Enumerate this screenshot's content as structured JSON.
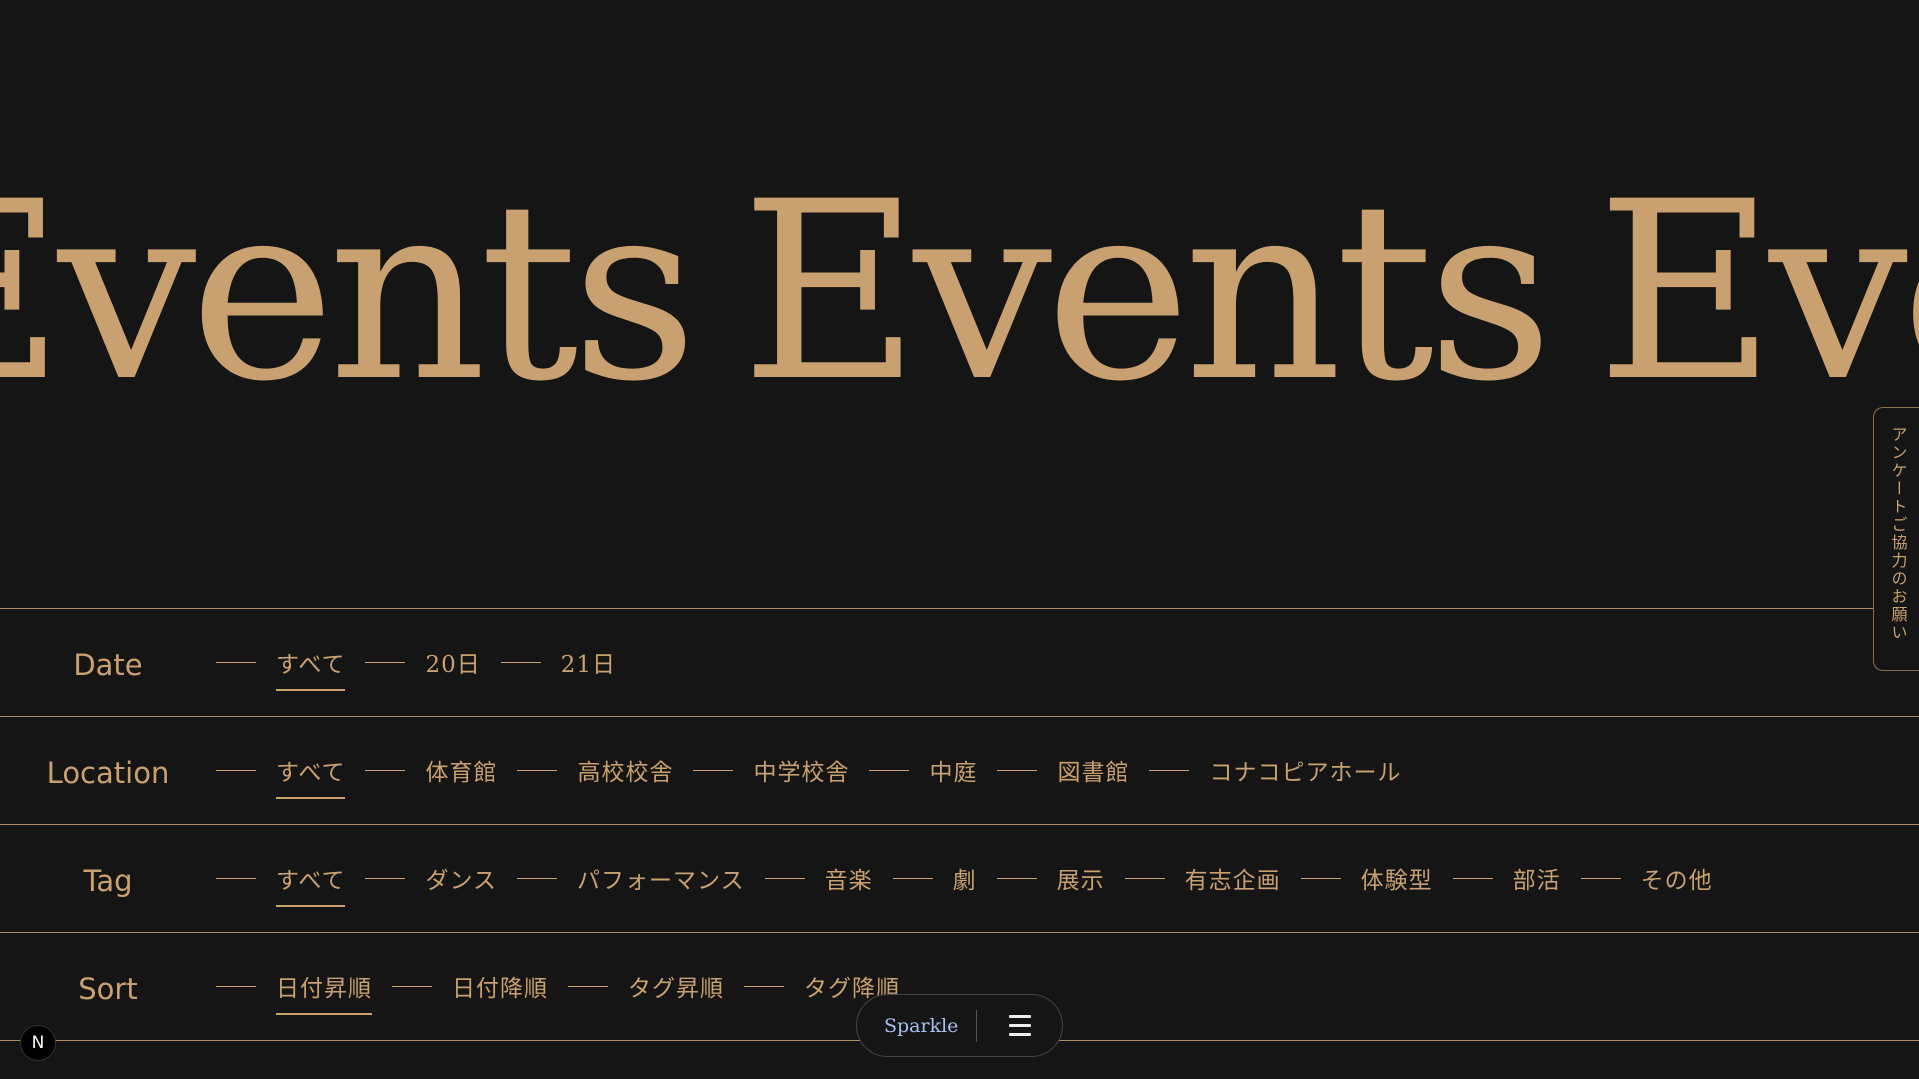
{
  "hero": {
    "words": [
      "Events",
      "Events",
      "Events"
    ]
  },
  "filters": {
    "date": {
      "label": "Date",
      "options": [
        "すべて",
        "20日",
        "21日"
      ],
      "active": 0
    },
    "location": {
      "label": "Location",
      "options": [
        "すべて",
        "体育館",
        "高校校舎",
        "中学校舎",
        "中庭",
        "図書館",
        "コナコピアホール"
      ],
      "active": 0
    },
    "tag": {
      "label": "Tag",
      "options": [
        "すべて",
        "ダンス",
        "パフォーマンス",
        "音楽",
        "劇",
        "展示",
        "有志企画",
        "体験型",
        "部活",
        "その他"
      ],
      "active": 0
    },
    "sort": {
      "label": "Sort",
      "options": [
        "日付昇順",
        "日付降順",
        "タグ昇順",
        "タグ降順"
      ],
      "active": 0
    }
  },
  "survey_tab": {
    "label": "アンケートご協力のお願い"
  },
  "bottom_bar": {
    "brand": "Sparkle",
    "menu_icon": "hamburger-menu-icon"
  },
  "badge": {
    "label": "N"
  },
  "colors": {
    "background": "#151515",
    "accent": "#c9a070",
    "brand": "#a8c0f0"
  }
}
